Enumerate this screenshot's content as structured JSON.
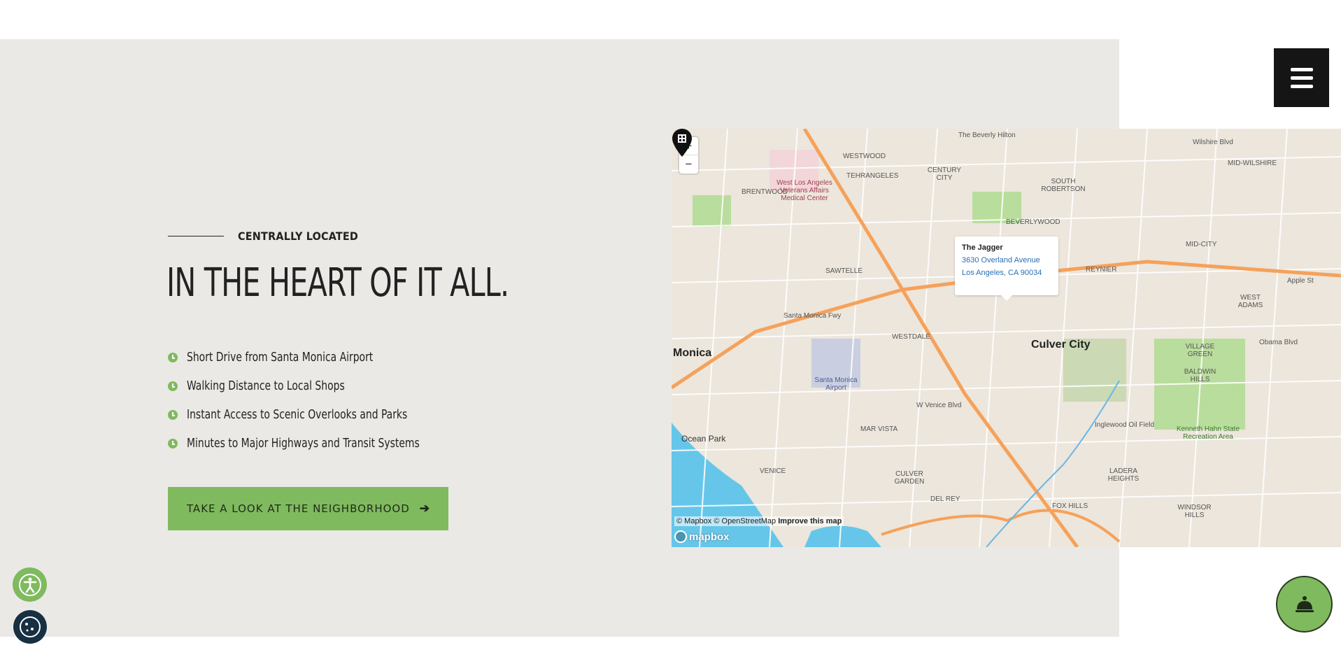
{
  "section": {
    "eyebrow": "CENTRALLY LOCATED",
    "heading": "IN THE HEART OF IT ALL.",
    "features": [
      "Short Drive from Santa Monica Airport",
      "Walking Distance to Local Shops",
      "Instant Access to Scenic Overlooks and Parks",
      "Minutes to Major Highways and Transit Systems"
    ],
    "cta_label": "TAKE A LOOK AT THE NEIGHBORHOOD"
  },
  "map": {
    "zoom_in": "+",
    "zoom_out": "−",
    "popup": {
      "title": "The Jagger",
      "address_line1": "3630 Overland Avenue",
      "address_line2": "Los Angeles, CA 90034"
    },
    "attribution": "© Mapbox © OpenStreetMap",
    "improve_link": "Improve this map",
    "logo": "mapbox",
    "places": {
      "culver_city": "Culver City",
      "monica": "Monica",
      "ocean_park": "Ocean Park",
      "santa_monica_airport": "Santa Monica Airport",
      "westwood": "WESTWOOD",
      "brentwood": "BRENTWOOD",
      "century_city": "CENTURY CITY",
      "sawtelle": "SAWTELLE",
      "westdale": "WESTDALE",
      "mar_vista": "MAR VISTA",
      "venice": "VENICE",
      "culver_garden": "CULVER GARDEN",
      "del_rey": "DEL REY",
      "ladera_heights": "LADERA HEIGHTS",
      "baldwin_hills": "BALDWIN HILLS",
      "village_green": "VILLAGE GREEN",
      "west_adams": "WEST ADAMS",
      "mid_city": "MID-CITY",
      "reynier": "REYNIER",
      "beverlywood": "BEVERLYWOOD",
      "south_robertson": "SOUTH ROBERTSON",
      "tehrangeles": "TEHRANGELES",
      "mid_wilshire": "MID-WILSHIRE",
      "fox_hills": "FOX HILLS",
      "windsor_hills": "WINDSOR HILLS",
      "kenneth_hahn": "Kenneth Hahn State Recreation Area",
      "inglewood_oil": "Inglewood Oil Field",
      "va_center": "West Los Angeles Veterans Affairs Medical Center",
      "beverly_hilton": "The Beverly Hilton",
      "santa_monica_fwy": "Santa Monica Fwy",
      "wilshire_blvd": "Wilshire Blvd",
      "venice_blvd": "W Venice Blvd",
      "obama_blvd": "Obama Blvd",
      "apple_st": "Apple St"
    }
  },
  "colors": {
    "accent_green": "#7fba5e",
    "panel_bg": "#ebe9e6",
    "menu_bg": "#151515",
    "cookie_bg": "#173042"
  },
  "icons": {
    "menu": "hamburger-icon",
    "feature": "clock-icon",
    "cta": "arrow-right-icon",
    "accessibility": "accessibility-icon",
    "cookie": "cookie-icon",
    "concierge": "concierge-bell-icon",
    "pin": "map-pin-icon"
  }
}
